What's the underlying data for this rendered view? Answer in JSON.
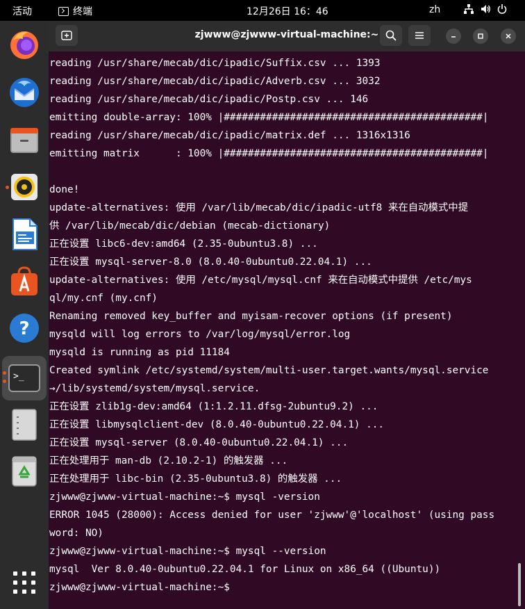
{
  "topbar": {
    "activities": "活动",
    "app_name": "终端",
    "clock": "12月26日  16：46",
    "lang": "zh"
  },
  "dock": {
    "items": [
      {
        "name": "firefox"
      },
      {
        "name": "thunderbird"
      },
      {
        "name": "files"
      },
      {
        "name": "rhythmbox"
      },
      {
        "name": "libreoffice-writer"
      },
      {
        "name": "app-center"
      },
      {
        "name": "help"
      },
      {
        "name": "terminal"
      },
      {
        "name": "text-editor"
      },
      {
        "name": "trash"
      },
      {
        "name": "show-apps"
      }
    ],
    "terminal_prompt": ">_"
  },
  "window": {
    "title": "zjwww@zjwww-virtual-machine:~"
  },
  "terminal": {
    "lines": [
      "reading /usr/share/mecab/dic/ipadic/Suffix.csv ... 1393",
      "reading /usr/share/mecab/dic/ipadic/Adverb.csv ... 3032",
      "reading /usr/share/mecab/dic/ipadic/Postp.csv ... 146",
      "emitting double-array: 100% |###########################################|",
      "reading /usr/share/mecab/dic/ipadic/matrix.def ... 1316x1316",
      "emitting matrix      : 100% |###########################################|",
      "",
      "done!",
      "update-alternatives: 使用 /var/lib/mecab/dic/ipadic-utf8 来在自动模式中提",
      "供 /var/lib/mecab/dic/debian (mecab-dictionary)",
      "正在设置 libc6-dev:amd64 (2.35-0ubuntu3.8) ...",
      "正在设置 mysql-server-8.0 (8.0.40-0ubuntu0.22.04.1) ...",
      "update-alternatives: 使用 /etc/mysql/mysql.cnf 来在自动模式中提供 /etc/mys",
      "ql/my.cnf (my.cnf)",
      "Renaming removed key_buffer and myisam-recover options (if present)",
      "mysqld will log errors to /var/log/mysql/error.log",
      "mysqld is running as pid 11184",
      "Created symlink /etc/systemd/system/multi-user.target.wants/mysql.service",
      "→/lib/systemd/system/mysql.service.",
      "正在设置 zlib1g-dev:amd64 (1:1.2.11.dfsg-2ubuntu9.2) ...",
      "正在设置 libmysqlclient-dev (8.0.40-0ubuntu0.22.04.1) ...",
      "正在设置 mysql-server (8.0.40-0ubuntu0.22.04.1) ...",
      "正在处理用于 man-db (2.10.2-1) 的触发器 ...",
      "正在处理用于 libc-bin (2.35-0ubuntu3.8) 的触发器 ...",
      "zjwww@zjwww-virtual-machine:~$ mysql -version",
      "ERROR 1045 (28000): Access denied for user 'zjwww'@'localhost' (using pass",
      "word: NO)",
      "zjwww@zjwww-virtual-machine:~$ mysql --version",
      "mysql  Ver 8.0.40-0ubuntu0.22.04.1 for Linux on x86_64 ((Ubuntu))",
      "zjwww@zjwww-virtual-machine:~$ "
    ]
  }
}
